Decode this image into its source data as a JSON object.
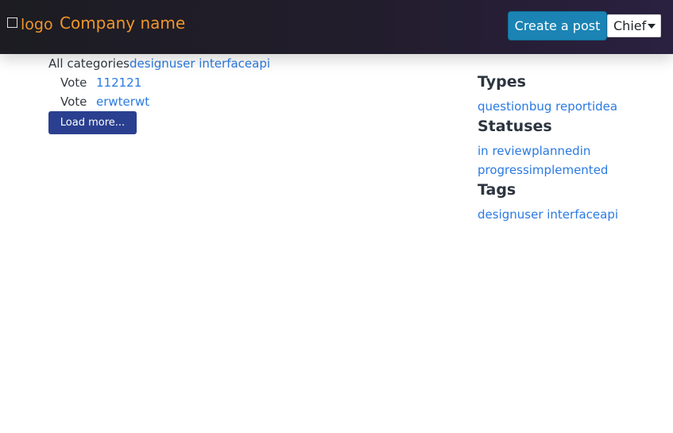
{
  "header": {
    "logo_alt": "logo",
    "company_name": "Company name",
    "create_post_label": "Create a post",
    "user_menu_label": "Chief"
  },
  "categories": {
    "all_label": "All categories",
    "items": [
      "design",
      "user interface",
      "api"
    ]
  },
  "posts": [
    {
      "vote_label": "Vote",
      "title": "112121"
    },
    {
      "vote_label": "Vote",
      "title": "erwterwt"
    }
  ],
  "load_more_label": "Load more...",
  "sidebar": {
    "types": {
      "heading": "Types",
      "items": [
        "question",
        "bug report",
        "idea"
      ]
    },
    "statuses": {
      "heading": "Statuses",
      "items": [
        "in review",
        "planned",
        "in progress",
        "implemented"
      ]
    },
    "tags": {
      "heading": "Tags",
      "items": [
        "design",
        "user interface",
        "api"
      ]
    }
  },
  "colors": {
    "header_bg": "#1c1c22",
    "brand_orange": "#f0952a",
    "create_button": "#1b84b5",
    "load_more_button": "#2a3f8f",
    "link": "#2a7ae2"
  }
}
